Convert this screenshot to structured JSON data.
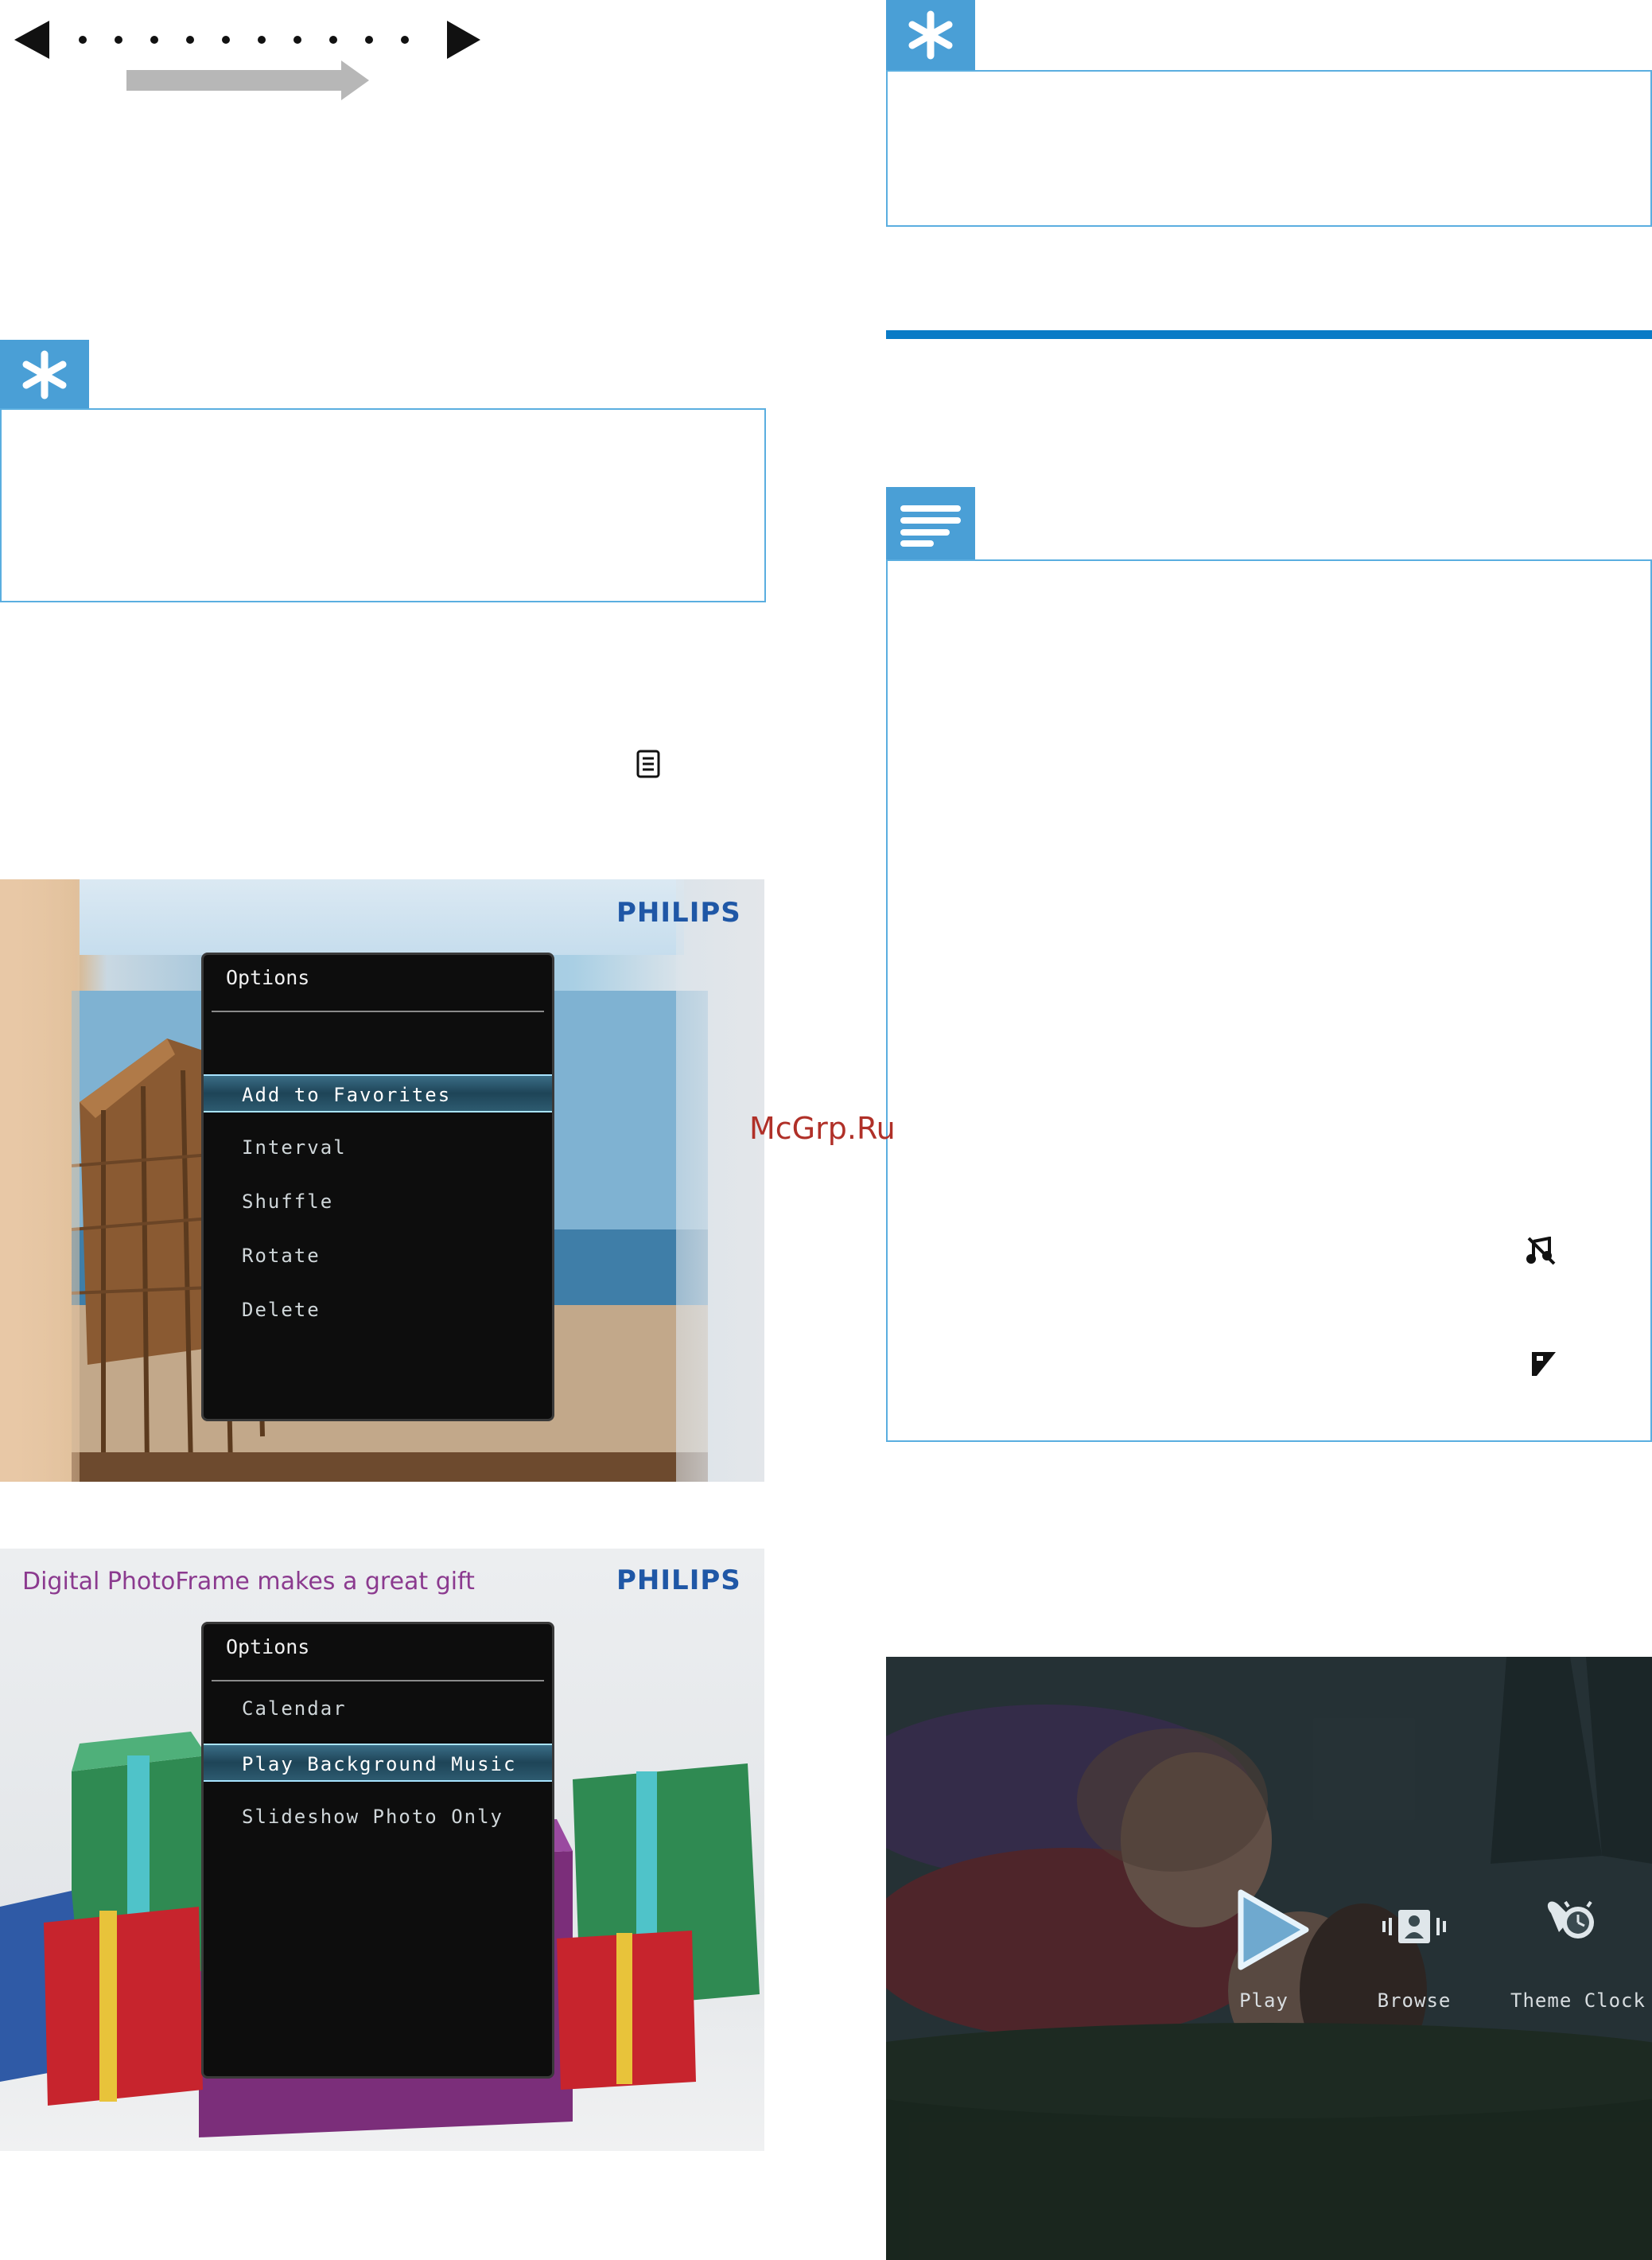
{
  "watermark": "McGrp.Ru",
  "icons": {
    "left_arrow": "triangle-left-icon",
    "right_arrow": "triangle-right-icon",
    "tip": "asterisk-icon",
    "note": "note-lines-icon",
    "menu_button": "menu-icon",
    "music_off": "music-off-icon",
    "photo_only": "photo-icon"
  },
  "colors": {
    "tip_blue": "#4a9fd6",
    "rule_blue": "#0a7bc6",
    "philips_blue": "#1f57a6",
    "highlight": "#2d5b70"
  },
  "screen1": {
    "brand": "PHILIPS",
    "menu_title": "Options",
    "items": [
      "Add to Favorites",
      "Interval",
      "Shuffle",
      "Rotate",
      "Delete"
    ],
    "selected_index": 0
  },
  "screen2": {
    "headline": "Digital PhotoFrame makes a great gift",
    "brand": "PHILIPS",
    "menu_title": "Options",
    "items": [
      "Calendar",
      "Play Background Music",
      "Slideshow Photo Only"
    ],
    "selected_index": 1
  },
  "screen3": {
    "items": [
      {
        "label": "Play",
        "icon": "play-icon"
      },
      {
        "label": "Browse",
        "icon": "browse-icon"
      },
      {
        "label": "Theme Clock",
        "icon": "clock-icon"
      }
    ]
  }
}
